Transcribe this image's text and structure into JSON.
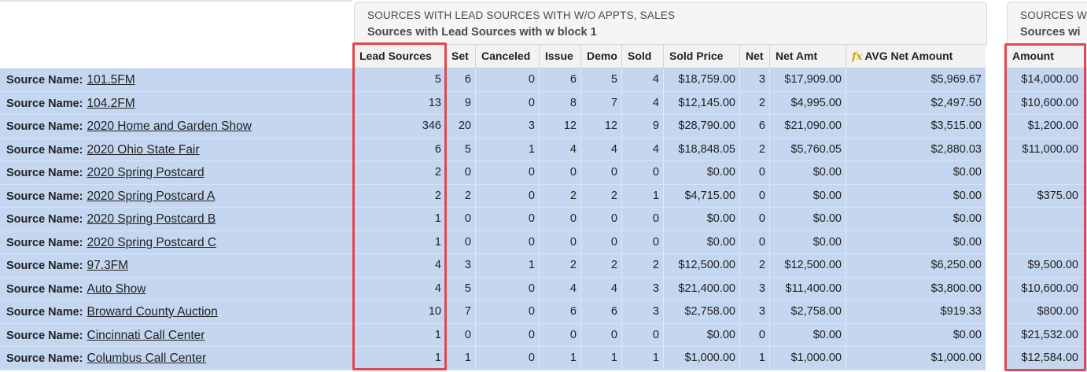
{
  "block1": {
    "title": "SOURCES WITH LEAD SOURCES WITH W/O APPTS, SALES",
    "subtitle": "Sources with Lead Sources with w block 1"
  },
  "block2": {
    "title": "SOURCES W",
    "subtitle": "Sources wi"
  },
  "columns": {
    "lead_sources": "Lead Sources",
    "set": "Set",
    "canceled": "Canceled",
    "issue": "Issue",
    "demo": "Demo",
    "sold": "Sold",
    "sold_price": "Sold Price",
    "net": "Net",
    "net_amt": "Net Amt",
    "avg_net_amount": "AVG Net Amount",
    "amount": "Amount"
  },
  "formula_icon": "fx",
  "row_label": "Source Name:",
  "rows": [
    {
      "name": "101.5FM",
      "lead_sources": "5",
      "set": "6",
      "canceled": "0",
      "issue": "6",
      "demo": "5",
      "sold": "4",
      "sold_price": "$18,759.00",
      "net": "3",
      "net_amt": "$17,909.00",
      "avg_net_amount": "$5,969.67",
      "amount": "$14,000.00"
    },
    {
      "name": "104.2FM",
      "lead_sources": "13",
      "set": "9",
      "canceled": "0",
      "issue": "8",
      "demo": "7",
      "sold": "4",
      "sold_price": "$12,145.00",
      "net": "2",
      "net_amt": "$4,995.00",
      "avg_net_amount": "$2,497.50",
      "amount": "$10,600.00"
    },
    {
      "name": "2020 Home and Garden Show",
      "lead_sources": "346",
      "set": "20",
      "canceled": "3",
      "issue": "12",
      "demo": "12",
      "sold": "9",
      "sold_price": "$28,790.00",
      "net": "6",
      "net_amt": "$21,090.00",
      "avg_net_amount": "$3,515.00",
      "amount": "$1,200.00"
    },
    {
      "name": "2020 Ohio State Fair",
      "lead_sources": "6",
      "set": "5",
      "canceled": "1",
      "issue": "4",
      "demo": "4",
      "sold": "4",
      "sold_price": "$18,848.05",
      "net": "2",
      "net_amt": "$5,760.05",
      "avg_net_amount": "$2,880.03",
      "amount": "$11,000.00"
    },
    {
      "name": "2020 Spring Postcard",
      "lead_sources": "2",
      "set": "0",
      "canceled": "0",
      "issue": "0",
      "demo": "0",
      "sold": "0",
      "sold_price": "$0.00",
      "net": "0",
      "net_amt": "$0.00",
      "avg_net_amount": "$0.00",
      "amount": ""
    },
    {
      "name": "2020 Spring Postcard A",
      "lead_sources": "2",
      "set": "2",
      "canceled": "0",
      "issue": "2",
      "demo": "2",
      "sold": "1",
      "sold_price": "$4,715.00",
      "net": "0",
      "net_amt": "$0.00",
      "avg_net_amount": "$0.00",
      "amount": "$375.00"
    },
    {
      "name": "2020 Spring Postcard B",
      "lead_sources": "1",
      "set": "0",
      "canceled": "0",
      "issue": "0",
      "demo": "0",
      "sold": "0",
      "sold_price": "$0.00",
      "net": "0",
      "net_amt": "$0.00",
      "avg_net_amount": "$0.00",
      "amount": ""
    },
    {
      "name": "2020 Spring Postcard C",
      "lead_sources": "1",
      "set": "0",
      "canceled": "0",
      "issue": "0",
      "demo": "0",
      "sold": "0",
      "sold_price": "$0.00",
      "net": "0",
      "net_amt": "$0.00",
      "avg_net_amount": "$0.00",
      "amount": ""
    },
    {
      "name": "97.3FM",
      "lead_sources": "4",
      "set": "3",
      "canceled": "1",
      "issue": "2",
      "demo": "2",
      "sold": "2",
      "sold_price": "$12,500.00",
      "net": "2",
      "net_amt": "$12,500.00",
      "avg_net_amount": "$6,250.00",
      "amount": "$9,500.00"
    },
    {
      "name": "Auto Show",
      "lead_sources": "4",
      "set": "5",
      "canceled": "0",
      "issue": "4",
      "demo": "4",
      "sold": "3",
      "sold_price": "$21,400.00",
      "net": "3",
      "net_amt": "$11,400.00",
      "avg_net_amount": "$3,800.00",
      "amount": "$10,600.00"
    },
    {
      "name": "Broward County Auction",
      "lead_sources": "10",
      "set": "7",
      "canceled": "0",
      "issue": "6",
      "demo": "6",
      "sold": "3",
      "sold_price": "$2,758.00",
      "net": "3",
      "net_amt": "$2,758.00",
      "avg_net_amount": "$919.33",
      "amount": "$800.00"
    },
    {
      "name": "Cincinnati Call Center",
      "lead_sources": "1",
      "set": "0",
      "canceled": "0",
      "issue": "0",
      "demo": "0",
      "sold": "0",
      "sold_price": "$0.00",
      "net": "0",
      "net_amt": "$0.00",
      "avg_net_amount": "$0.00",
      "amount": "$21,532.00"
    },
    {
      "name": "Columbus Call Center",
      "lead_sources": "1",
      "set": "1",
      "canceled": "0",
      "issue": "1",
      "demo": "1",
      "sold": "1",
      "sold_price": "$1,000.00",
      "net": "1",
      "net_amt": "$1,000.00",
      "avg_net_amount": "$1,000.00",
      "amount": "$12,584.00"
    }
  ],
  "colors": {
    "row_bg": "#c5d6f0",
    "header_bg": "#f2f2f2",
    "highlight": "#e0484f"
  }
}
